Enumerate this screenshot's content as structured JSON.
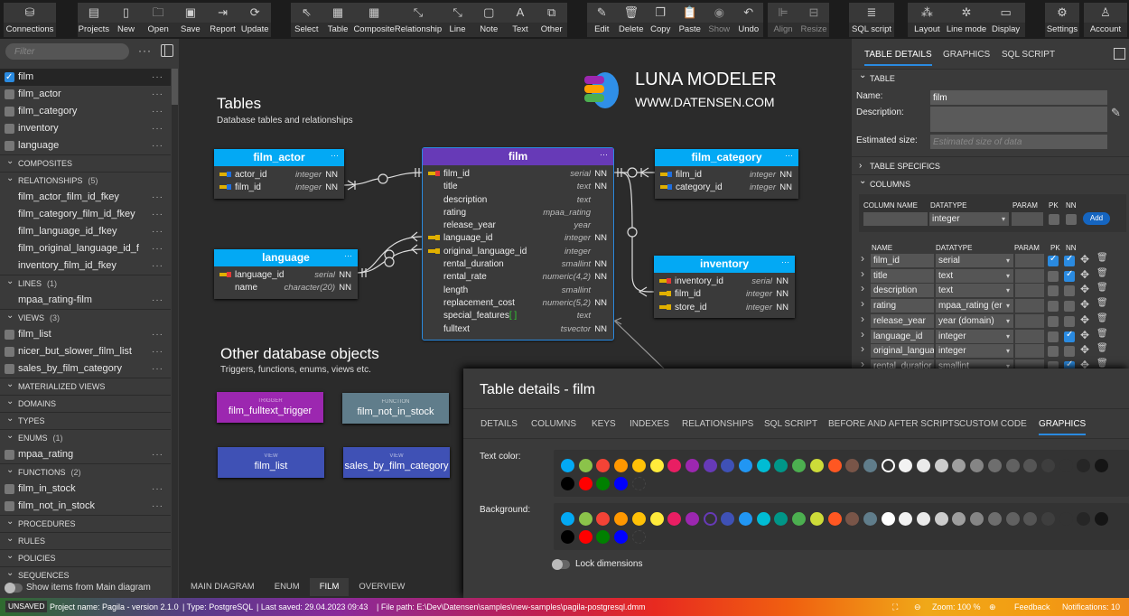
{
  "toolbar": {
    "groups": [
      [
        {
          "label": "Connections",
          "icon": "database-icon",
          "glyph": "⛁"
        }
      ],
      [
        {
          "label": "Projects",
          "icon": "projects-icon",
          "glyph": "▤"
        },
        {
          "label": "New",
          "icon": "new-file-icon",
          "glyph": "▯"
        },
        {
          "label": "Open",
          "icon": "folder-open-icon",
          "glyph": "🗀"
        },
        {
          "label": "Save",
          "icon": "save-icon",
          "glyph": "▣"
        },
        {
          "label": "Report",
          "icon": "report-icon",
          "glyph": "⇥"
        },
        {
          "label": "Update",
          "icon": "update-icon",
          "glyph": "⟳"
        }
      ],
      [
        {
          "label": "Select",
          "icon": "cursor-icon",
          "glyph": "⇖"
        },
        {
          "label": "Table",
          "icon": "table-icon",
          "glyph": "▦"
        },
        {
          "label": "Composite",
          "icon": "composite-icon",
          "glyph": "▦"
        },
        {
          "label": "Relationship",
          "icon": "relationship-icon",
          "glyph": "⤡"
        },
        {
          "label": "Line",
          "icon": "line-icon",
          "glyph": "⤡"
        },
        {
          "label": "Note",
          "icon": "note-icon",
          "glyph": "▢"
        },
        {
          "label": "Text",
          "icon": "text-icon",
          "glyph": "A"
        },
        {
          "label": "Other",
          "icon": "other-icon",
          "glyph": "⧉"
        }
      ],
      [
        {
          "label": "Edit",
          "icon": "pencil-icon",
          "glyph": "✎"
        },
        {
          "label": "Delete",
          "icon": "trash-icon",
          "glyph": "🗑"
        },
        {
          "label": "Copy",
          "icon": "copy-icon",
          "glyph": "❐"
        },
        {
          "label": "Paste",
          "icon": "paste-icon",
          "glyph": "📋"
        },
        {
          "label": "Show",
          "icon": "eye-icon",
          "glyph": "◉",
          "disabled": true
        },
        {
          "label": "Undo",
          "icon": "undo-icon",
          "glyph": "↶"
        }
      ],
      [
        {
          "label": "Align",
          "icon": "align-icon",
          "glyph": "⊫",
          "disabled": true
        },
        {
          "label": "Resize",
          "icon": "resize-icon",
          "glyph": "⊟",
          "disabled": true
        }
      ],
      [
        {
          "label": "SQL script",
          "icon": "sql-script-icon",
          "glyph": "≣"
        }
      ],
      [
        {
          "label": "Layout",
          "icon": "layout-icon",
          "glyph": "⁂"
        },
        {
          "label": "Line mode",
          "icon": "line-mode-icon",
          "glyph": "✲"
        },
        {
          "label": "Display",
          "icon": "display-icon",
          "glyph": "▭"
        }
      ],
      [
        {
          "label": "Settings",
          "icon": "gear-icon",
          "glyph": "⚙"
        }
      ],
      [
        {
          "label": "Account",
          "icon": "user-icon",
          "glyph": "♙"
        }
      ]
    ]
  },
  "sidebar": {
    "filter_placeholder": "Filter",
    "more": "···",
    "items": [
      {
        "type": "item",
        "label": "film",
        "checkbox": true,
        "checked": true,
        "selected": true
      },
      {
        "type": "item",
        "label": "film_actor",
        "checkbox": true
      },
      {
        "type": "item",
        "label": "film_category",
        "checkbox": true
      },
      {
        "type": "item",
        "label": "inventory",
        "checkbox": true
      },
      {
        "type": "item",
        "label": "language",
        "checkbox": true
      },
      {
        "type": "header",
        "label": "COMPOSITES"
      },
      {
        "type": "header",
        "label": "RELATIONSHIPS",
        "count": "(5)"
      },
      {
        "type": "item",
        "label": "film_actor_film_id_fkey"
      },
      {
        "type": "item",
        "label": "film_category_film_id_fkey"
      },
      {
        "type": "item",
        "label": "film_language_id_fkey"
      },
      {
        "type": "item",
        "label": "film_original_language_id_f"
      },
      {
        "type": "item",
        "label": "inventory_film_id_fkey"
      },
      {
        "type": "header",
        "label": "LINES",
        "count": "(1)"
      },
      {
        "type": "item",
        "label": "mpaa_rating-film"
      },
      {
        "type": "header",
        "label": "VIEWS",
        "count": "(3)"
      },
      {
        "type": "item",
        "label": "film_list",
        "checkbox": true
      },
      {
        "type": "item",
        "label": "nicer_but_slower_film_list",
        "checkbox": true
      },
      {
        "type": "item",
        "label": "sales_by_film_category",
        "checkbox": true
      },
      {
        "type": "header",
        "label": "MATERIALIZED VIEWS"
      },
      {
        "type": "header",
        "label": "DOMAINS"
      },
      {
        "type": "header",
        "label": "TYPES"
      },
      {
        "type": "header",
        "label": "ENUMS",
        "count": "(1)"
      },
      {
        "type": "item",
        "label": "mpaa_rating",
        "checkbox": true
      },
      {
        "type": "header",
        "label": "FUNCTIONS",
        "count": "(2)"
      },
      {
        "type": "item",
        "label": "film_in_stock",
        "checkbox": true
      },
      {
        "type": "item",
        "label": "film_not_in_stock",
        "checkbox": true
      },
      {
        "type": "header",
        "label": "PROCEDURES"
      },
      {
        "type": "header",
        "label": "RULES"
      },
      {
        "type": "header",
        "label": "POLICIES"
      },
      {
        "type": "header",
        "label": "SEQUENCES"
      }
    ],
    "show_main_label": "Show items from Main diagram"
  },
  "canvas": {
    "tables_title": "Tables",
    "tables_subtitle": "Database tables and relationships",
    "logo_title": "LUNA MODELER",
    "logo_url": "WWW.DATENSEN.COM",
    "other_title": "Other database objects",
    "other_subtitle": "Triggers, functions, enums, views etc.",
    "tabs": [
      {
        "label": "MAIN DIAGRAM"
      },
      {
        "label": "ENUM"
      },
      {
        "label": "FILM",
        "active": true
      },
      {
        "label": "OVERVIEW"
      }
    ],
    "tables": [
      {
        "id": "film_actor",
        "name": "film_actor",
        "color": "#03a9f4",
        "rows": [
          {
            "key": "pfk",
            "name": "actor_id",
            "type": "integer",
            "nn": "NN"
          },
          {
            "key": "pfk",
            "name": "film_id",
            "type": "integer",
            "nn": "NN"
          }
        ]
      },
      {
        "id": "film",
        "name": "film",
        "color": "#673ab7",
        "rows": [
          {
            "key": "pk",
            "name": "film_id",
            "type": "serial",
            "nn": "NN"
          },
          {
            "key": "",
            "name": "title",
            "type": "text",
            "nn": "NN"
          },
          {
            "key": "",
            "name": "description",
            "type": "text",
            "nn": ""
          },
          {
            "key": "",
            "name": "rating",
            "type": "mpaa_rating",
            "nn": ""
          },
          {
            "key": "",
            "name": "release_year",
            "type": "year",
            "nn": ""
          },
          {
            "key": "fk",
            "name": "language_id",
            "type": "integer",
            "nn": "NN"
          },
          {
            "key": "fk",
            "name": "original_language_id",
            "type": "integer",
            "nn": ""
          },
          {
            "key": "",
            "name": "rental_duration",
            "type": "smallint",
            "nn": "NN"
          },
          {
            "key": "",
            "name": "rental_rate",
            "type": "numeric(4,2)",
            "nn": "NN"
          },
          {
            "key": "",
            "name": "length",
            "type": "smallint",
            "nn": ""
          },
          {
            "key": "",
            "name": "replacement_cost",
            "type": "numeric(5,2)",
            "nn": "NN"
          },
          {
            "key": "",
            "name": "special_features",
            "array": "[ ]",
            "type": "text",
            "nn": ""
          },
          {
            "key": "",
            "name": "fulltext",
            "type": "tsvector",
            "nn": "NN"
          }
        ]
      },
      {
        "id": "film_category",
        "name": "film_category",
        "color": "#03a9f4",
        "rows": [
          {
            "key": "pfk",
            "name": "film_id",
            "type": "integer",
            "nn": "NN"
          },
          {
            "key": "pfk",
            "name": "category_id",
            "type": "integer",
            "nn": "NN"
          }
        ]
      },
      {
        "id": "language",
        "name": "language",
        "color": "#03a9f4",
        "rows": [
          {
            "key": "pk",
            "name": "language_id",
            "type": "serial",
            "nn": "NN"
          },
          {
            "key": "",
            "name": "name",
            "type": "character(20)",
            "nn": "NN"
          }
        ]
      },
      {
        "id": "inventory",
        "name": "inventory",
        "color": "#03a9f4",
        "rows": [
          {
            "key": "pk",
            "name": "inventory_id",
            "type": "serial",
            "nn": "NN"
          },
          {
            "key": "fk",
            "name": "film_id",
            "type": "integer",
            "nn": "NN"
          },
          {
            "key": "fk",
            "name": "store_id",
            "type": "integer",
            "nn": "NN"
          }
        ]
      }
    ],
    "objects": [
      {
        "kind": "TRIGGER",
        "name": "film_fulltext_trigger",
        "color": "#9c27b0"
      },
      {
        "kind": "FUNCTION",
        "name": "film_not_in_stock",
        "color": "#607d8b"
      },
      {
        "kind": "VIEW",
        "name": "film_list",
        "color": "#3f51b5"
      },
      {
        "kind": "VIEW",
        "name": "sales_by_film_category",
        "color": "#3f51b5"
      }
    ],
    "more": "···"
  },
  "right_panel": {
    "tabs": [
      {
        "label": "TABLE DETAILS",
        "active": true
      },
      {
        "label": "GRAPHICS"
      },
      {
        "label": "SQL SCRIPT"
      }
    ],
    "table_section": "TABLE",
    "name_label": "Name:",
    "name_value": "film",
    "description_label": "Description:",
    "description_value": "",
    "size_label": "Estimated size:",
    "size_placeholder": "Estimated size of data",
    "specifics_section": "TABLE SPECIFICS",
    "columns_section": "COLUMNS",
    "new_column": {
      "h_name": "COLUMN NAME",
      "h_type": "DATATYPE",
      "h_param": "PARAM",
      "h_pk": "PK",
      "h_nn": "NN",
      "name": "",
      "datatype": "integer",
      "param": "",
      "add_label": "Add"
    },
    "columns_header": {
      "name": "NAME",
      "type": "DATATYPE",
      "param": "PARAM",
      "pk": "PK",
      "nn": "NN"
    },
    "columns": [
      {
        "name": "film_id",
        "type": "serial",
        "pk": true,
        "nn": true
      },
      {
        "name": "title",
        "type": "text",
        "pk": false,
        "nn": true
      },
      {
        "name": "description",
        "type": "text",
        "pk": false,
        "nn": false
      },
      {
        "name": "rating",
        "type": "mpaa_rating (er",
        "pk": false,
        "nn": false
      },
      {
        "name": "release_year",
        "type": "year (domain)",
        "pk": false,
        "nn": false
      },
      {
        "name": "language_id",
        "type": "integer",
        "pk": false,
        "nn": true
      },
      {
        "name": "original_langua",
        "type": "integer",
        "pk": false,
        "nn": false
      },
      {
        "name": "rental_duratior",
        "type": "smallint",
        "pk": false,
        "nn": true
      }
    ]
  },
  "modal": {
    "title": "Table details - film",
    "tabs": [
      {
        "label": "DETAILS"
      },
      {
        "label": "COLUMNS"
      },
      {
        "label": "KEYS"
      },
      {
        "label": "INDEXES"
      },
      {
        "label": "RELATIONSHIPS"
      },
      {
        "label": "SQL SCRIPT"
      },
      {
        "label": "BEFORE AND AFTER SCRIPTS"
      },
      {
        "label": "CUSTOM CODE"
      },
      {
        "label": "GRAPHICS",
        "active": true
      }
    ],
    "text_color_label": "Text color:",
    "background_label": "Background:",
    "text_color_selected": "#ffffff",
    "background_selected": "#673ab7",
    "palette": [
      "#03a9f4",
      "#8bc34a",
      "#f44336",
      "#ff9800",
      "#ffc107",
      "#ffeb3b",
      "#e91e63",
      "#9c27b0",
      "#673ab7",
      "#3f51b5",
      "#2196f3",
      "#00bcd4",
      "#009688",
      "#4caf50",
      "#cddc39",
      "#ff5722",
      "#795548",
      "#607d8b",
      "#ffffff",
      "#f2f2f2",
      "#eaeaea",
      "#cccccc",
      "#9e9e9e",
      "#858585",
      "#6e6e6e",
      "#616161",
      "#555555",
      "#3e3e3e",
      "#333333",
      "#262626",
      "#151515",
      "#000000",
      "#ff0000",
      "#008000",
      "#0000ff"
    ],
    "lock_label": "Lock dimensions",
    "lock_on": false
  },
  "status": {
    "unsaved": "UNSAVED",
    "project": "Project name: Pagila - version 2.1.0",
    "type": "| Type: PostgreSQL",
    "saved": "| Last saved: 29.04.2023 09:43",
    "path": "| File path: E:\\Dev\\Datensen\\samples\\new-samples\\pagila-postgresql.dmm",
    "zoom": "Zoom: 100 %",
    "feedback": "Feedback",
    "notifications": "Notifications: 10"
  }
}
